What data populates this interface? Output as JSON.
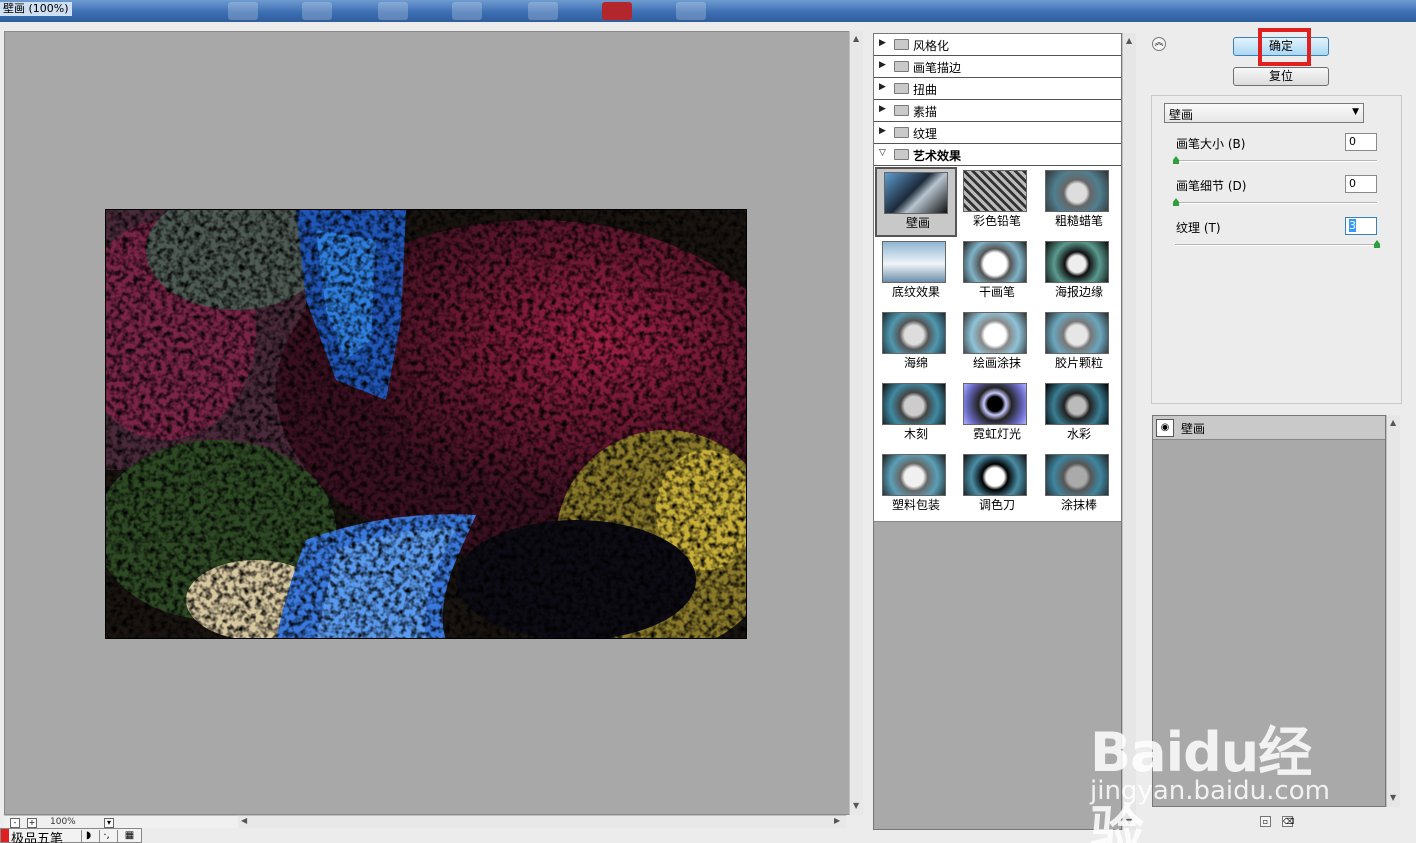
{
  "window": {
    "title": "壁画 (100%)"
  },
  "preview": {
    "zoom": "100%"
  },
  "ime": {
    "label": "极品五笔"
  },
  "filter_categories": [
    {
      "label": "风格化",
      "expanded": false
    },
    {
      "label": "画笔描边",
      "expanded": false
    },
    {
      "label": "扭曲",
      "expanded": false
    },
    {
      "label": "素描",
      "expanded": false
    },
    {
      "label": "纹理",
      "expanded": false
    },
    {
      "label": "艺术效果",
      "expanded": true
    }
  ],
  "artistic_filters": [
    {
      "label": "壁画",
      "selected": true
    },
    {
      "label": "彩色铅笔"
    },
    {
      "label": "粗糙蜡笔"
    },
    {
      "label": "底纹效果"
    },
    {
      "label": "干画笔"
    },
    {
      "label": "海报边缘"
    },
    {
      "label": "海绵"
    },
    {
      "label": "绘画涂抹"
    },
    {
      "label": "胶片颗粒"
    },
    {
      "label": "木刻"
    },
    {
      "label": "霓虹灯光"
    },
    {
      "label": "水彩"
    },
    {
      "label": "塑料包装"
    },
    {
      "label": "调色刀"
    },
    {
      "label": "涂抹棒"
    }
  ],
  "buttons": {
    "ok": "确定",
    "reset": "复位"
  },
  "filter_select": {
    "value": "壁画"
  },
  "params": [
    {
      "label": "画笔大小 (B)",
      "value": "0",
      "slider_fraction": 0.0
    },
    {
      "label": "画笔细节 (D)",
      "value": "0",
      "slider_fraction": 0.0
    },
    {
      "label": "纹理 (T)",
      "value": "3",
      "slider_fraction": 1.0
    }
  ],
  "layers": {
    "active_label": "壁画"
  },
  "watermark": {
    "main": "Baidu经验",
    "sub": "jingyan.baidu.com"
  },
  "colors": {
    "highlight": "#e02020",
    "panel_bg": "#a8a8a8",
    "ok_button": "#a9d8f3"
  }
}
